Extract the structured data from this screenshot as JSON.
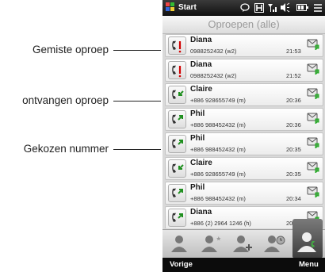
{
  "callouts": [
    {
      "label": "Gemiste oproep"
    },
    {
      "label": "ontvangen oproep"
    },
    {
      "label": "Gekozen nummer"
    }
  ],
  "status_bar": {
    "title": "Start",
    "icons": [
      "windows-logo-icon",
      "notification-icon",
      "hsdpa-icon",
      "signal-icon",
      "volume-icon",
      "battery-icon",
      "menu-icon"
    ]
  },
  "header": {
    "title": "Oproepen (alle)"
  },
  "calls": [
    {
      "type": "missed",
      "name": "Diana",
      "number": "0988252432 (w2)",
      "time": "21:53"
    },
    {
      "type": "missed",
      "name": "Diana",
      "number": "0988252432 (w2)",
      "time": "21:52"
    },
    {
      "type": "received",
      "name": "Claire",
      "number": "+886 928655749 (m)",
      "time": "20:36"
    },
    {
      "type": "dialed",
      "name": "Phil",
      "number": "+886 988452432 (m)",
      "time": "20:36"
    },
    {
      "type": "dialed",
      "name": "Phil",
      "number": "+886 988452432 (m)",
      "time": "20:35"
    },
    {
      "type": "received",
      "name": "Claire",
      "number": "+886 928655749 (m)",
      "time": "20:35"
    },
    {
      "type": "dialed",
      "name": "Phil",
      "number": "+886 988452432 (m)",
      "time": "20:34"
    },
    {
      "type": "dialed",
      "name": "Diana",
      "number": "+886 (2) 2964 1246 (h)",
      "time": "20:34"
    }
  ],
  "tabs": [
    "contacts-tab",
    "favorites-tab",
    "add-contact-tab",
    "call-history-tab",
    "call-history-active-tab"
  ],
  "softkeys": {
    "left": "Vorige",
    "right": "Menu"
  },
  "colors": {
    "missed_arrow": "#d10000",
    "received_arrow": "#1f8f1f",
    "dialed_arrow": "#1f8f1f"
  }
}
